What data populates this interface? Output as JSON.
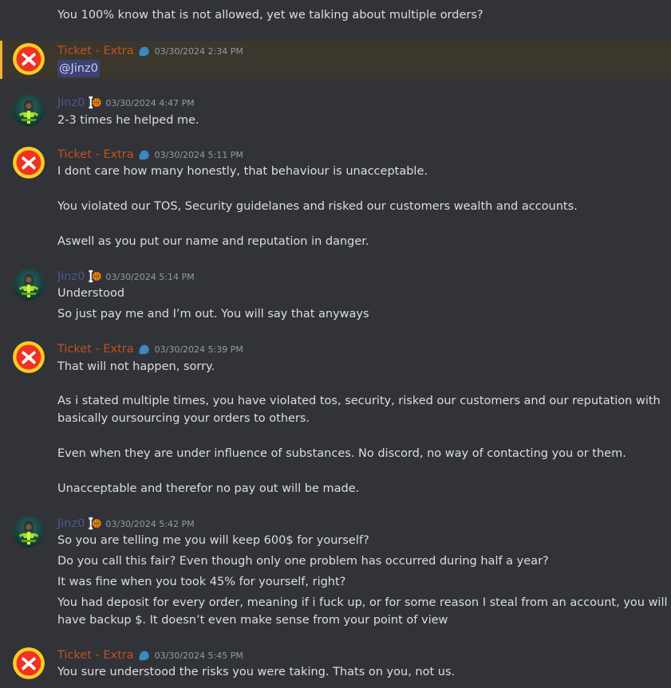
{
  "colors": {
    "background": "#313338",
    "text": "#dbdee1",
    "timestamp": "#949ba4",
    "ticket_name": "#c0521e",
    "jinz_name": "#4a5b91",
    "highlight_bg": "#3b372d",
    "highlight_bar": "#f0b232",
    "mention_bg": "#3c4270",
    "mention_text": "#c9cdfb"
  },
  "icons": {
    "ticket_avatar": "red-x-circle-icon",
    "jinz_avatar": "hooded-figure-avatar-icon",
    "ticket_badge": "speaking-head-icon",
    "jinz_badge": "bone-basketball-icon"
  },
  "top": {
    "text": "You 100% know that is not allowed, yet we talking about multiple orders?"
  },
  "messages": [
    {
      "author": "Ticket - Extra",
      "timestamp": "03/30/2024 2:34 PM",
      "mention": "@Jinz0"
    },
    {
      "author": "Jinz0",
      "timestamp": "03/30/2024 4:47 PM",
      "lines": [
        "2-3 times he helped me."
      ]
    },
    {
      "author": "Ticket - Extra",
      "timestamp": "03/30/2024 5:11 PM",
      "lines": [
        "I dont care how many honestly, that behaviour is unacceptable.",
        "You violated our TOS, Security guidelanes and risked our customers wealth and accounts.",
        "Aswell as you put our name and reputation in danger."
      ]
    },
    {
      "author": "Jinz0",
      "timestamp": "03/30/2024 5:14 PM",
      "lines": [
        "Understood",
        "So just pay me and I’m out. You will say that anyways"
      ]
    },
    {
      "author": "Ticket - Extra",
      "timestamp": "03/30/2024 5:39 PM",
      "lines": [
        "That will not happen, sorry.",
        "As i stated multiple times, you have violated tos, security, risked our customers and our reputation with",
        "basically oursourcing your orders to others.",
        "Even when they are under influence of substances. No discord, no way of contacting you or them.",
        "Unacceptable and therefor no pay out will be made."
      ]
    },
    {
      "author": "Jinz0",
      "timestamp": "03/30/2024 5:42 PM",
      "lines": [
        "So you are telling me you will keep 600$ for yourself?",
        "Do you call this fair? Even though only one problem has occurred during half a year?",
        "It was fine when you took 45% for yourself, right?",
        "You had deposit for every order, meaning if i fuck up, or for some reason I steal from an account, you will",
        "have backup $. It doesn’t even make sense from your point of view"
      ]
    },
    {
      "author": "Ticket - Extra",
      "timestamp": "03/30/2024 5:45 PM",
      "lines": [
        "You sure understood the risks you were taking. Thats on you, not us."
      ]
    }
  ]
}
